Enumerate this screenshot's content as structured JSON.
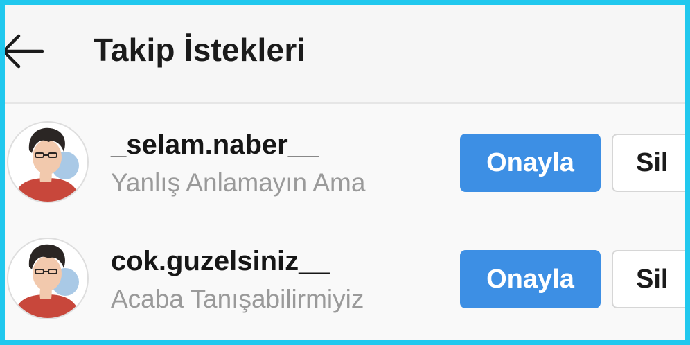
{
  "header": {
    "back_icon": "arrow-left-icon",
    "title": "Takip İstekleri"
  },
  "requests": [
    {
      "avatar_icon": "user-avatar-illustration",
      "username": "_selam.naber__",
      "subtext": "Yanlış Anlamayın Ama",
      "approve_label": "Onayla",
      "delete_label": "Sil"
    },
    {
      "avatar_icon": "user-avatar-illustration",
      "username": "cok.guzelsiniz__",
      "subtext": "Acaba Tanışabilirmiyiz",
      "approve_label": "Onayla",
      "delete_label": "Sil"
    }
  ],
  "colors": {
    "border_frame": "#21c8ee",
    "approve_button": "#3d8fe4",
    "subtext": "#9a9a9a"
  }
}
